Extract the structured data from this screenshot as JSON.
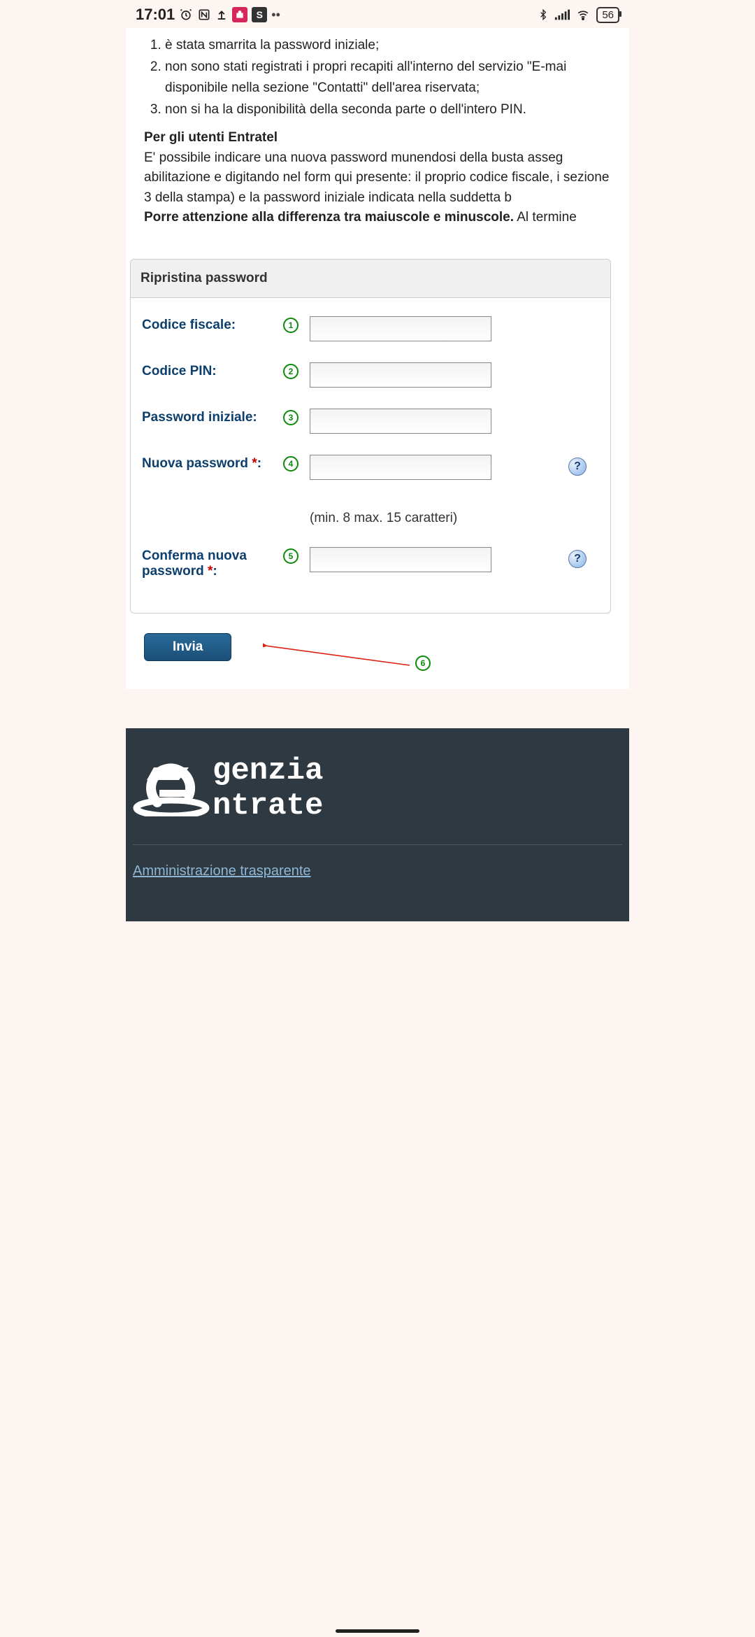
{
  "statusBar": {
    "time": "17:01",
    "battery": "56"
  },
  "intro": {
    "items": [
      "è stata smarrita la password iniziale;",
      "non sono stati registrati i propri recapiti all'interno del servizio \"E-mai disponibile nella sezione \"Contatti\" dell'area riservata;",
      "non si ha la disponibilità della seconda parte o dell'intero PIN."
    ],
    "subheading": "Per gli utenti Entratel",
    "text1": "E' possibile indicare una nuova password munendosi della busta asseg abilitazione e digitando nel form qui presente: il proprio codice fiscale, i sezione 3 della stampa) e la password iniziale indicata nella suddetta b",
    "bold": "Porre attenzione alla differenza tra maiuscole e minuscole.",
    "tail": " Al termine "
  },
  "form": {
    "panelTitle": "Ripristina password",
    "fields": {
      "f1": {
        "label": "Codice fiscale:",
        "step": "1"
      },
      "f2": {
        "label": "Codice PIN:",
        "step": "2"
      },
      "f3": {
        "label": "Password iniziale:",
        "step": "3"
      },
      "f4": {
        "label": "Nuova password ",
        "step": "4",
        "hint": "(min. 8 max. 15 caratteri)"
      },
      "f5": {
        "label": "Conferma nuova password ",
        "step": "5"
      }
    },
    "step6": "6",
    "requiredMark": "*",
    "colon": ":",
    "help": "?",
    "submit": "Invia"
  },
  "footer": {
    "brand1": "genzia",
    "brand2": "ntrate",
    "link": "Amministrazione trasparente"
  }
}
